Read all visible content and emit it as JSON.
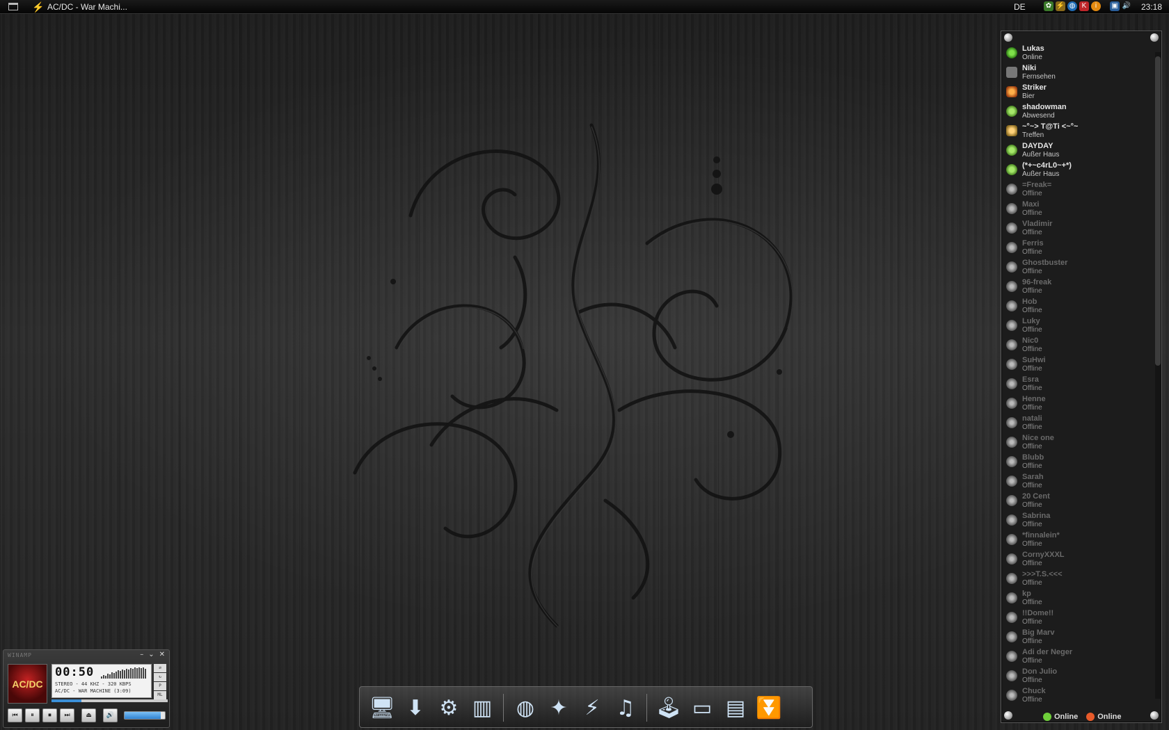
{
  "taskbar": {
    "window_title": "AC/DC - War Machi...",
    "language": "DE",
    "clock": "23:18",
    "tray_icons": [
      "leaf-icon",
      "lightning-icon",
      "globe-icon",
      "k-icon",
      "info-icon",
      "network-icon",
      "volume-icon"
    ]
  },
  "contacts": {
    "items": [
      {
        "name": "Lukas",
        "status": "Online",
        "icon": "online"
      },
      {
        "name": "Niki",
        "status": "Fernsehen",
        "icon": "tv"
      },
      {
        "name": "Striker",
        "status": "Bier",
        "icon": "beer"
      },
      {
        "name": "shadowman",
        "status": "Abwesend",
        "icon": "away"
      },
      {
        "name": "~°~> T@Ti <~°~",
        "status": "Treffen",
        "icon": "meet"
      },
      {
        "name": "DAYDAY",
        "status": "Außer Haus",
        "icon": "away"
      },
      {
        "name": "(*+~c4rL0~+*)",
        "status": "Außer Haus",
        "icon": "away"
      },
      {
        "name": "=Freak=",
        "status": "Offline",
        "icon": "off"
      },
      {
        "name": "Maxi",
        "status": "Offline",
        "icon": "off"
      },
      {
        "name": "Vladimir",
        "status": "Offline",
        "icon": "off"
      },
      {
        "name": "Ferris",
        "status": "Offline",
        "icon": "off"
      },
      {
        "name": "Ghostbuster",
        "status": "Offline",
        "icon": "off"
      },
      {
        "name": "96-freak",
        "status": "Offline",
        "icon": "off"
      },
      {
        "name": "Hob",
        "status": "Offline",
        "icon": "off"
      },
      {
        "name": "Luky",
        "status": "Offline",
        "icon": "off"
      },
      {
        "name": "Nic0",
        "status": "Offline",
        "icon": "off"
      },
      {
        "name": "SuHwi",
        "status": "Offline",
        "icon": "off"
      },
      {
        "name": "Esra",
        "status": "Offline",
        "icon": "off"
      },
      {
        "name": "Henne",
        "status": "Offline",
        "icon": "off"
      },
      {
        "name": "natali",
        "status": "Offline",
        "icon": "off"
      },
      {
        "name": "Nice one",
        "status": "Offline",
        "icon": "off"
      },
      {
        "name": "Blubb",
        "status": "Offline",
        "icon": "off"
      },
      {
        "name": "Sarah",
        "status": "Offline",
        "icon": "off"
      },
      {
        "name": "20 Cent",
        "status": "Offline",
        "icon": "off"
      },
      {
        "name": "Sabrina",
        "status": "Offline",
        "icon": "off"
      },
      {
        "name": "*finnalein*",
        "status": "Offline",
        "icon": "off"
      },
      {
        "name": "CornyXXXL",
        "status": "Offline",
        "icon": "off"
      },
      {
        "name": ">>>T.S.<<<",
        "status": "Offline",
        "icon": "off"
      },
      {
        "name": "kp",
        "status": "Offline",
        "icon": "off"
      },
      {
        "name": "!!Dome!!",
        "status": "Offline",
        "icon": "off"
      },
      {
        "name": "Big Marv",
        "status": "Offline",
        "icon": "off"
      },
      {
        "name": "Adi der Neger",
        "status": "Offline",
        "icon": "off"
      },
      {
        "name": "Don Julio",
        "status": "Offline",
        "icon": "off"
      },
      {
        "name": "Chuck",
        "status": "Offline",
        "icon": "off"
      }
    ],
    "footer": [
      {
        "label": "Online",
        "icon": "icq-flower-icon",
        "color": "#6fcf3a"
      },
      {
        "label": "Online",
        "icon": "msn-icon",
        "color": "#e85a2a"
      }
    ]
  },
  "winamp": {
    "title": "WINAMP",
    "time": "00:50",
    "info": "STEREO - 44 KHZ - 320 KBPS",
    "track": "AC/DC - WAR MACHINE (3:09)",
    "side_buttons": [
      "⇄",
      "↻",
      "P",
      "ML"
    ],
    "cover_text": "AC/DC",
    "progress": 0.26,
    "volume": 0.9,
    "visualizer": [
      3,
      5,
      4,
      7,
      6,
      9,
      8,
      10,
      12,
      11,
      13,
      12,
      14,
      13,
      15,
      14,
      16,
      15,
      16,
      15,
      16,
      14
    ],
    "controls": [
      "⏮",
      "⏸",
      "⏹",
      "⏭",
      "⏏",
      "🔊"
    ]
  },
  "dock": {
    "items": [
      {
        "name": "computer-icon",
        "glyph": "🖥"
      },
      {
        "name": "downloads-icon",
        "glyph": "⬇"
      },
      {
        "name": "settings-gears-icon",
        "glyph": "⚙"
      },
      {
        "name": "recycle-bin-icon",
        "glyph": "▥"
      },
      {
        "name": "globe-icon",
        "glyph": "◍"
      },
      {
        "name": "firefox-icon",
        "glyph": "✦"
      },
      {
        "name": "lightning-icon",
        "glyph": "⚡"
      },
      {
        "name": "music-note-icon",
        "glyph": "♫"
      },
      {
        "name": "joystick-icon",
        "glyph": "🕹"
      },
      {
        "name": "desktop-window-icon",
        "glyph": "▭"
      },
      {
        "name": "document-icon",
        "glyph": "▤"
      },
      {
        "name": "downloader-chevrons-icon",
        "glyph": "⏬"
      }
    ],
    "separators_after": [
      3,
      7
    ]
  }
}
